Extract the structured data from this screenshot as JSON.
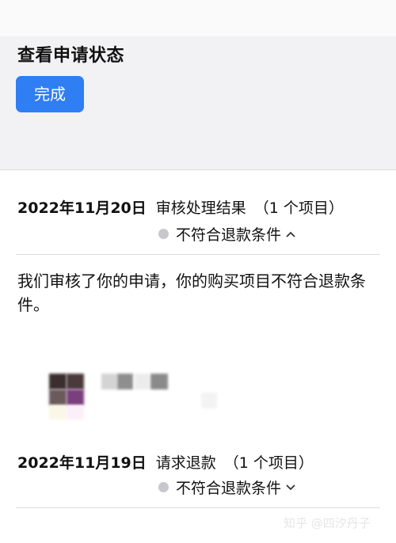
{
  "header": {
    "title": "查看申请状态",
    "done_label": "完成"
  },
  "entries": [
    {
      "date": "2022年11月20日",
      "title": "审核处理结果",
      "count": "（1 个项目）",
      "status": "不符合退款条件",
      "chevron_icon": "chevron-up-icon"
    },
    {
      "date": "2022年11月19日",
      "title": "请求退款",
      "count": "（1 个项目）",
      "status": "不符合退款条件",
      "chevron_icon": "chevron-down-icon"
    }
  ],
  "message": "我们审核了你的申请，你的购买项目不符合退款条件。",
  "watermark": "知乎 @四汐丹子",
  "colors": {
    "accent": "#2f7ef3",
    "header_bg": "#f2f2f4",
    "status_dot": "#c8c8cc",
    "divider": "#dcdcdc"
  }
}
